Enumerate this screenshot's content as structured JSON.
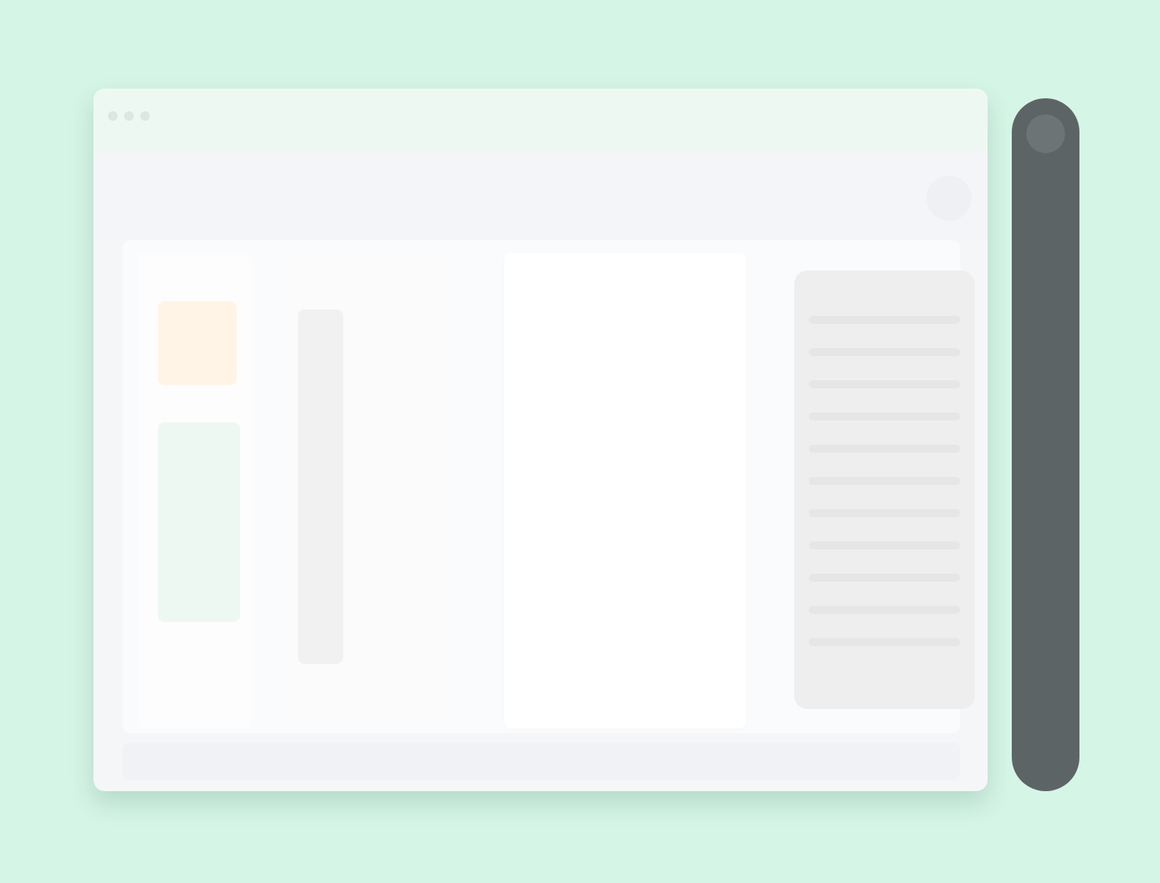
{
  "window": {
    "title": ""
  },
  "toolbar": {
    "title": "",
    "action_label": ""
  },
  "columns": {
    "col1_title": "",
    "col2_title": "",
    "col3_title": "",
    "col4_title": ""
  },
  "bottom": {
    "label": ""
  },
  "icons": {
    "window_close": "close-dot-icon",
    "window_minimize": "minimize-dot-icon",
    "window_maximize": "maximize-dot-icon",
    "toolbar_action": "search-icon",
    "sidebar_toggle": "panel-icon"
  },
  "colors": {
    "desktop_bg": "#d5f5e6",
    "window_bg": "#f5f6f8",
    "titlebar_bg": "#eef8f2",
    "accent_orange": "#fff4e6",
    "accent_green": "#eef8f2",
    "side_panel": "#5d6466"
  }
}
